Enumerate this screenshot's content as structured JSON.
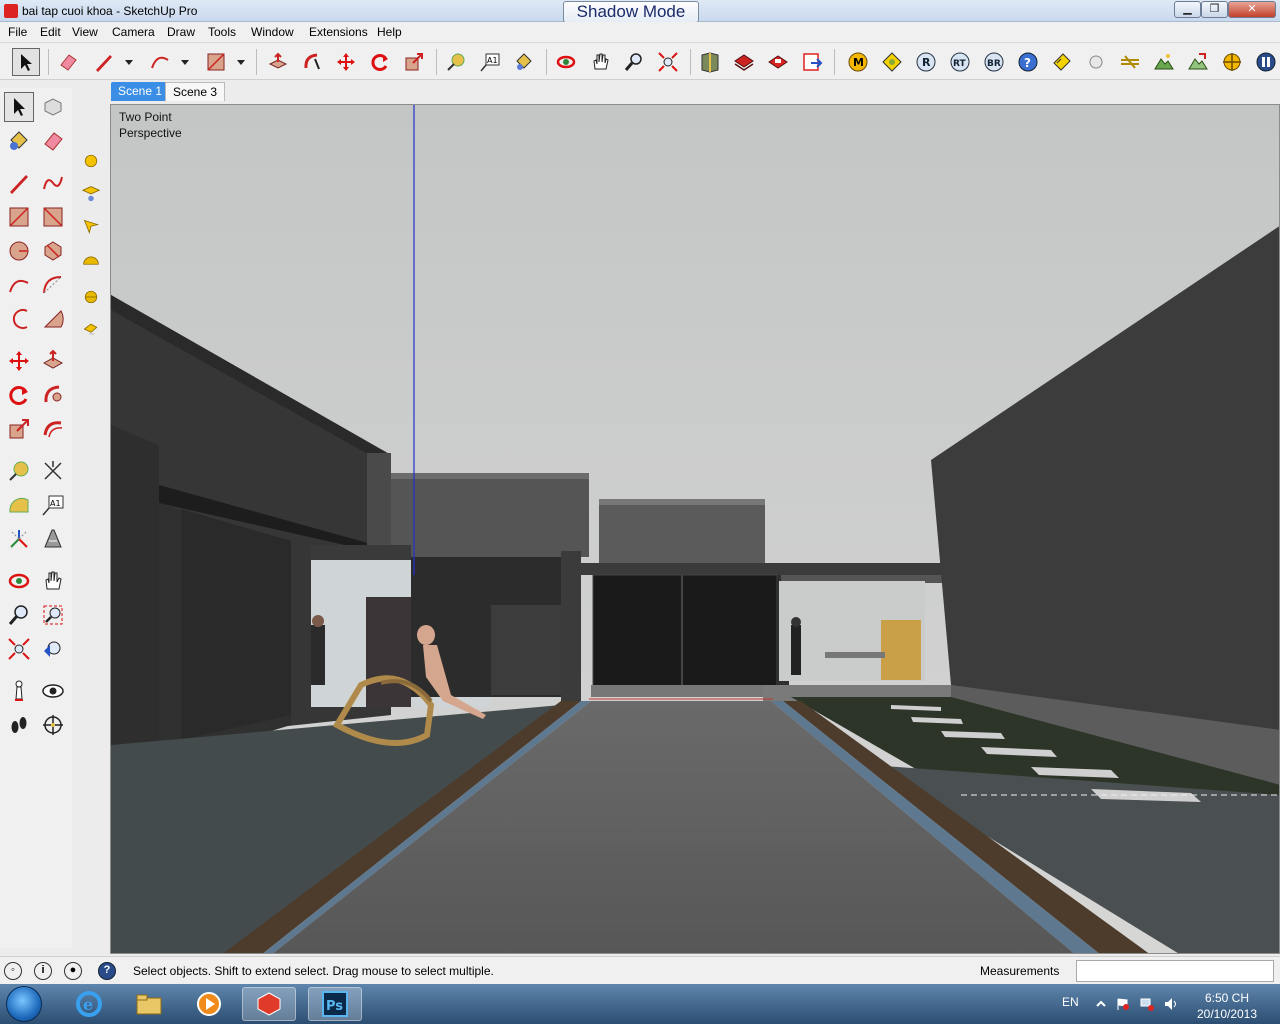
{
  "window": {
    "title": "bai tap cuoi khoa - SketchUp Pro",
    "overlay_title": "Shadow Mode",
    "min_label": "▁",
    "max_label": "❐",
    "close_label": "✕"
  },
  "menu": {
    "items": [
      {
        "label": "File"
      },
      {
        "label": "Edit"
      },
      {
        "label": "View"
      },
      {
        "label": "Camera"
      },
      {
        "label": "Draw"
      },
      {
        "label": "Tools"
      },
      {
        "label": "Window"
      },
      {
        "label": "Extensions"
      },
      {
        "label": "Help"
      }
    ]
  },
  "toolbar": {
    "tools": [
      {
        "icon": "select-arrow-icon",
        "selected": true
      },
      {
        "icon": "eraser-icon"
      },
      {
        "icon": "pencil-line-icon",
        "dropdown": true
      },
      {
        "icon": "arc-icon",
        "dropdown": true
      },
      {
        "icon": "rectangle-icon",
        "dropdown": true
      },
      {
        "icon": "push-pull-icon"
      },
      {
        "icon": "follow-me-icon"
      },
      {
        "icon": "move-icon"
      },
      {
        "icon": "rotate-icon"
      },
      {
        "icon": "scale-icon"
      },
      {
        "icon": "tape-measure-icon"
      },
      {
        "icon": "text-label-icon"
      },
      {
        "icon": "paint-bucket-icon"
      },
      {
        "icon": "orbit-icon"
      },
      {
        "icon": "pan-hand-icon"
      },
      {
        "icon": "zoom-icon"
      },
      {
        "icon": "zoom-extents-icon"
      },
      {
        "icon": "warehouse-icon"
      },
      {
        "icon": "get-models-icon"
      },
      {
        "icon": "share-model-icon"
      },
      {
        "icon": "extension-warehouse-icon"
      }
    ],
    "plugins": [
      {
        "icon": "plugin-m-icon",
        "label": "M"
      },
      {
        "icon": "plugin-tag-icon",
        "label": "◆"
      },
      {
        "icon": "plugin-r-icon",
        "label": "R"
      },
      {
        "icon": "plugin-rt-icon",
        "label": "RT"
      },
      {
        "icon": "plugin-br-icon",
        "label": "BR"
      },
      {
        "icon": "help-circle-icon",
        "label": "?"
      },
      {
        "icon": "plugin-tag2-icon",
        "label": "◆"
      },
      {
        "icon": "plugin-sphere-icon",
        "label": "●"
      },
      {
        "icon": "plugin-lines-icon",
        "label": "≈"
      },
      {
        "icon": "plugin-landscape-icon",
        "label": "▲"
      },
      {
        "icon": "plugin-landscape2-icon",
        "label": "▲"
      },
      {
        "icon": "plugin-target-icon",
        "label": "⊕"
      },
      {
        "icon": "pause-icon",
        "label": "❚❚"
      }
    ]
  },
  "left_tools": [
    "select-arrow-icon",
    "make-component-icon",
    "paint-bucket-icon",
    "eraser-icon",
    "pencil-line-icon",
    "freehand-icon",
    "rectangle-icon",
    "rotated-rectangle-icon",
    "circle-icon",
    "polygon-icon",
    "arc-icon",
    "two-point-arc-icon",
    "three-point-arc-icon",
    "pie-icon",
    "move-icon",
    "push-pull-icon",
    "rotate-icon",
    "follow-me-icon",
    "scale-icon",
    "offset-icon",
    "tape-measure-icon",
    "dimension-icon",
    "protractor-icon",
    "text-label-icon",
    "axes-icon",
    "3d-text-icon",
    "orbit-icon",
    "pan-hand-icon",
    "zoom-icon",
    "zoom-window-icon",
    "zoom-extents-icon",
    "previous-view-icon",
    "position-camera-icon",
    "look-around-icon",
    "walk-icon",
    "section-plane-icon"
  ],
  "section_tools": [
    "sphere-light-icon",
    "spot-light-icon",
    "arrow-light-icon",
    "dome-light-icon",
    "half-sphere-light-icon",
    "light-tag-icon"
  ],
  "scenes": [
    {
      "label": "Scene 1",
      "active": true
    },
    {
      "label": "Scene 3",
      "active": false
    }
  ],
  "viewport": {
    "view_label_line1": "Two Point",
    "view_label_line2": "Perspective"
  },
  "status": {
    "text": "Select objects. Shift to extend select. Drag mouse to select multiple.",
    "measurements_label": "Measurements",
    "measurements_value": ""
  },
  "taskbar": {
    "apps": [
      {
        "icon": "internet-explorer-icon",
        "active": false
      },
      {
        "icon": "file-explorer-icon",
        "active": false
      },
      {
        "icon": "media-player-icon",
        "active": false
      },
      {
        "icon": "sketchup-icon",
        "active": true
      },
      {
        "icon": "photoshop-icon",
        "active": false,
        "label": "Ps"
      }
    ],
    "language": "EN",
    "time": "6:50 CH",
    "date": "20/10/2013"
  },
  "colors": {
    "accent_blue": "#3b8ee6",
    "sky": "#c7c9c9",
    "wall_dark": "#3b3b3b",
    "pool_gray": "#5c5c5c",
    "wood_deck": "#4f3e2f",
    "grass": "#2e3a2a"
  }
}
